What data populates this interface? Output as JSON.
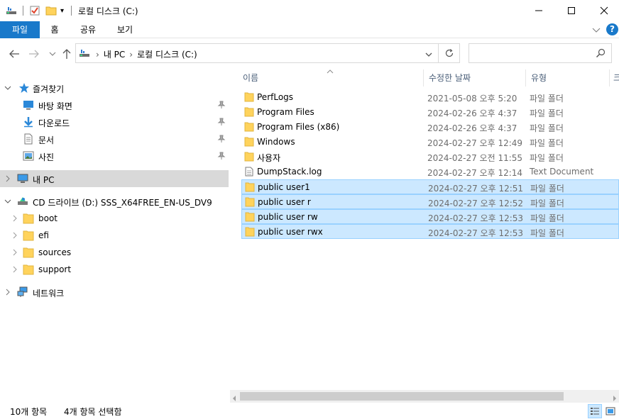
{
  "window": {
    "title": "로컬 디스크 (C:)",
    "qa_dropdown_glyph": "▾"
  },
  "ribbon": {
    "tabs": [
      "파일",
      "홈",
      "공유",
      "보기"
    ]
  },
  "navigation": {
    "breadcrumbs": [
      "내 PC",
      "로컬 디스크 (C:)"
    ],
    "separator": "›",
    "search_placeholder": ""
  },
  "sidebar": {
    "quick_access": {
      "label": "즐겨찾기",
      "items": [
        {
          "label": "바탕 화면",
          "icon": "desktop-icon",
          "pinned": true
        },
        {
          "label": "다운로드",
          "icon": "download-icon",
          "pinned": true
        },
        {
          "label": "문서",
          "icon": "document-icon",
          "pinned": true
        },
        {
          "label": "사진",
          "icon": "pictures-icon",
          "pinned": true
        }
      ]
    },
    "this_pc": {
      "label": "내 PC"
    },
    "cd_drive": {
      "label": "CD 드라이브 (D:) SSS_X64FREE_EN-US_DV9",
      "children": [
        "boot",
        "efi",
        "sources",
        "support"
      ]
    },
    "network": {
      "label": "네트워크"
    }
  },
  "columns": {
    "name": "이름",
    "date": "수정한 날짜",
    "type": "유형",
    "size_partial": "크"
  },
  "files": [
    {
      "name": "PerfLogs",
      "date": "2021-05-08 오후 5:20",
      "type": "파일 폴더",
      "icon": "folder-icon",
      "selected": false
    },
    {
      "name": "Program Files",
      "date": "2024-02-26 오후 4:37",
      "type": "파일 폴더",
      "icon": "folder-icon",
      "selected": false
    },
    {
      "name": "Program Files (x86)",
      "date": "2024-02-26 오후 4:37",
      "type": "파일 폴더",
      "icon": "folder-icon",
      "selected": false
    },
    {
      "name": "Windows",
      "date": "2024-02-27 오후 12:49",
      "type": "파일 폴더",
      "icon": "folder-icon",
      "selected": false
    },
    {
      "name": "사용자",
      "date": "2024-02-27 오전 11:55",
      "type": "파일 폴더",
      "icon": "folder-icon",
      "selected": false
    },
    {
      "name": "DumpStack.log",
      "date": "2024-02-27 오후 12:14",
      "type": "Text Document",
      "icon": "text-file-icon",
      "selected": false
    },
    {
      "name": "public user1",
      "date": "2024-02-27 오후 12:51",
      "type": "파일 폴더",
      "icon": "folder-icon",
      "selected": true
    },
    {
      "name": "public user r",
      "date": "2024-02-27 오후 12:52",
      "type": "파일 폴더",
      "icon": "folder-icon",
      "selected": true
    },
    {
      "name": "public user rw",
      "date": "2024-02-27 오후 12:53",
      "type": "파일 폴더",
      "icon": "folder-icon",
      "selected": true
    },
    {
      "name": "public user rwx",
      "date": "2024-02-27 오후 12:53",
      "type": "파일 폴더",
      "icon": "folder-icon",
      "selected": true
    }
  ],
  "status": {
    "count": "10개 항목",
    "selection": "4개 항목 선택함"
  },
  "colors": {
    "accent": "#1979ca",
    "selection_bg": "#cce8ff",
    "selection_border": "#99d1ff",
    "folder": "#ffd35c",
    "header_text": "#4c607a"
  }
}
